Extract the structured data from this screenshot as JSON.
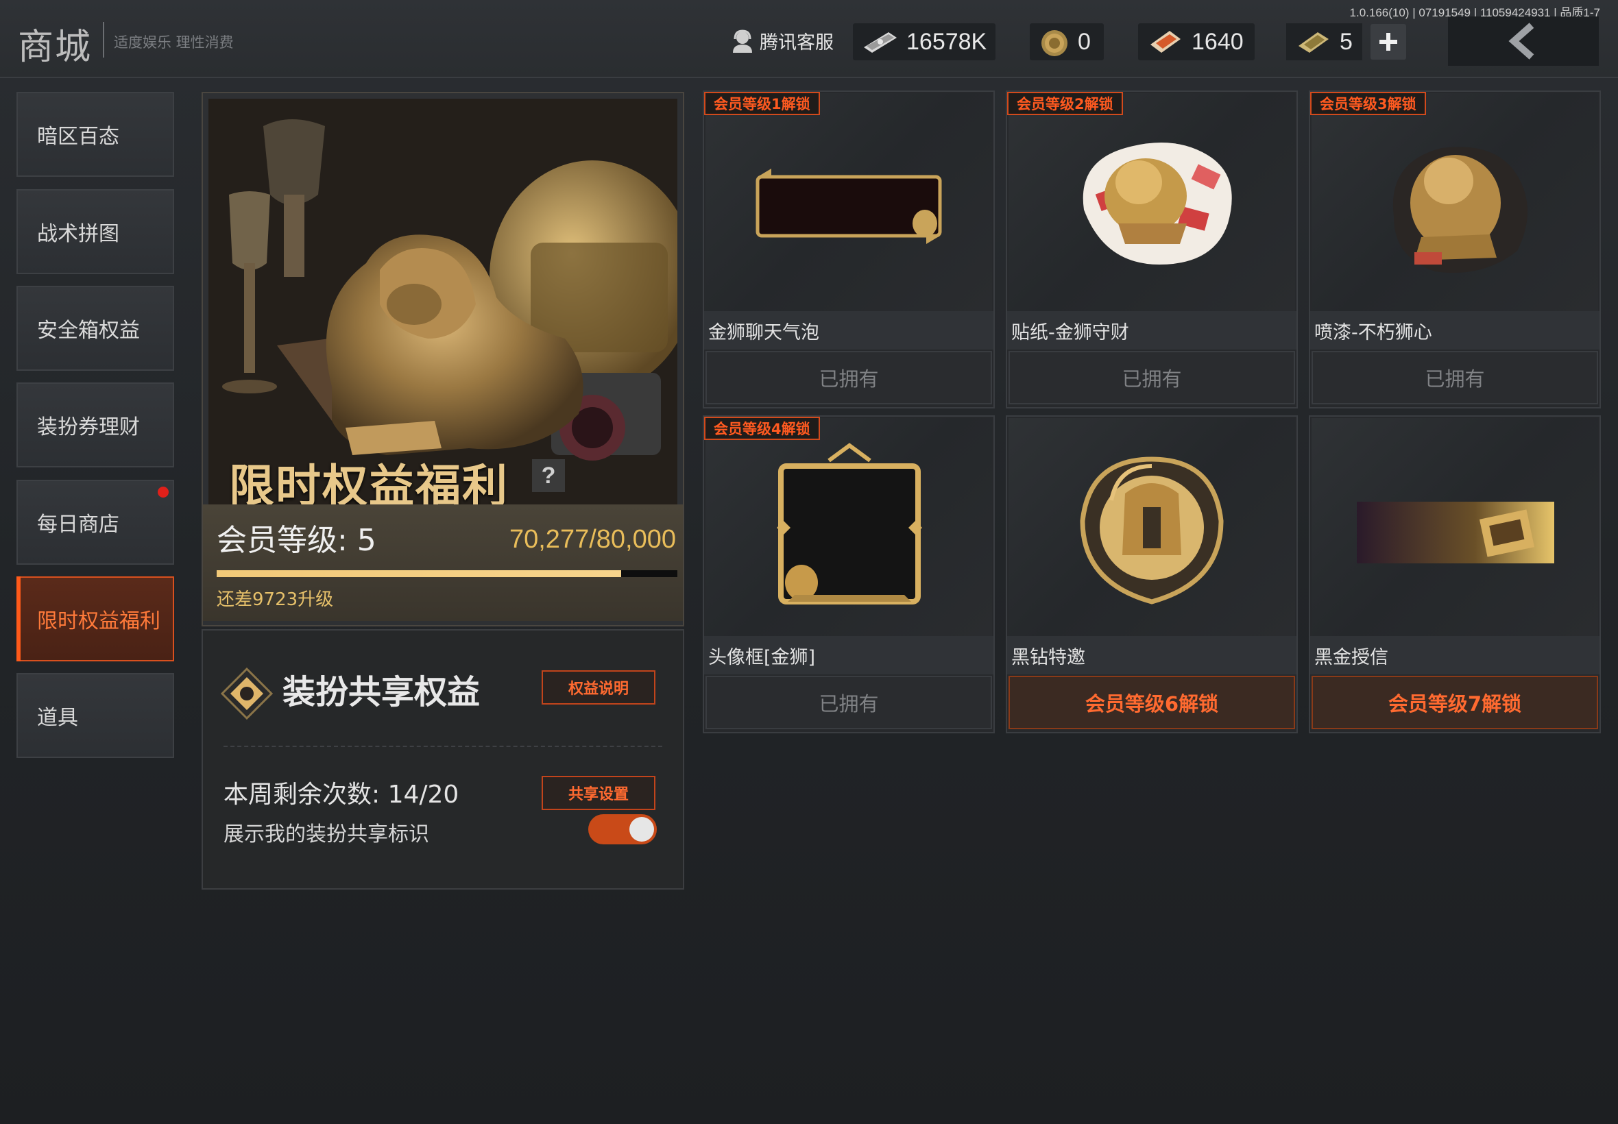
{
  "header": {
    "version": "1.0.166(10) | 07191549 | 11059424931 | 品质1-7",
    "title": "商城",
    "subtitle": "适度娱乐 理性消费",
    "support_label": "腾讯客服",
    "currencies": [
      {
        "icon": "banknote-icon",
        "value": "16578K"
      },
      {
        "icon": "coin-icon",
        "value": "0"
      },
      {
        "icon": "ticket-icon",
        "value": "1640"
      },
      {
        "icon": "voucher-icon",
        "value": "5"
      }
    ],
    "plus_label": "+"
  },
  "sidebar": {
    "items": [
      {
        "label": "暗区百态"
      },
      {
        "label": "战术拼图"
      },
      {
        "label": "安全箱权益"
      },
      {
        "label": "装扮券理财"
      },
      {
        "label": "每日商店",
        "notification": true
      },
      {
        "label": "限时权益福利",
        "active": true
      },
      {
        "label": "道具"
      }
    ]
  },
  "feature": {
    "title": "限时权益福利",
    "help": "?",
    "level_label": "会员等级: 5",
    "progress_text": "70,277/80,000",
    "progress_fraction": 0.878,
    "need_text": "还差9723升级"
  },
  "share": {
    "title": "装扮共享权益",
    "info_button": "权益说明",
    "settings_button": "共享设置",
    "remain_text": "本周剩余次数: 14/20",
    "show_label": "展示我的装扮共享标识",
    "show_enabled": true
  },
  "cards": [
    {
      "badge": "会员等级1解锁",
      "name": "金狮聊天气泡",
      "button": "已拥有",
      "locked": false,
      "icon": "chat-bubble-icon"
    },
    {
      "badge": "会员等级2解锁",
      "name": "贴纸-金狮守财",
      "button": "已拥有",
      "locked": false,
      "icon": "lion-sticker-icon"
    },
    {
      "badge": "会员等级3解锁",
      "name": "喷漆-不朽狮心",
      "button": "已拥有",
      "locked": false,
      "icon": "lion-spray-icon"
    },
    {
      "badge": "会员等级4解锁",
      "name": "头像框[金狮]",
      "button": "已拥有",
      "locked": false,
      "icon": "avatar-frame-icon"
    },
    {
      "badge": "",
      "name": "黑钻特邀",
      "button": "会员等级6解锁",
      "locked": true,
      "icon": "helmet-emblem-icon"
    },
    {
      "badge": "",
      "name": "黑金授信",
      "button": "会员等级7解锁",
      "locked": true,
      "icon": "gold-card-icon"
    }
  ],
  "colors": {
    "accent": "#ff6a30",
    "gold": "#e9bd5a",
    "active_border": "#d9501e"
  }
}
